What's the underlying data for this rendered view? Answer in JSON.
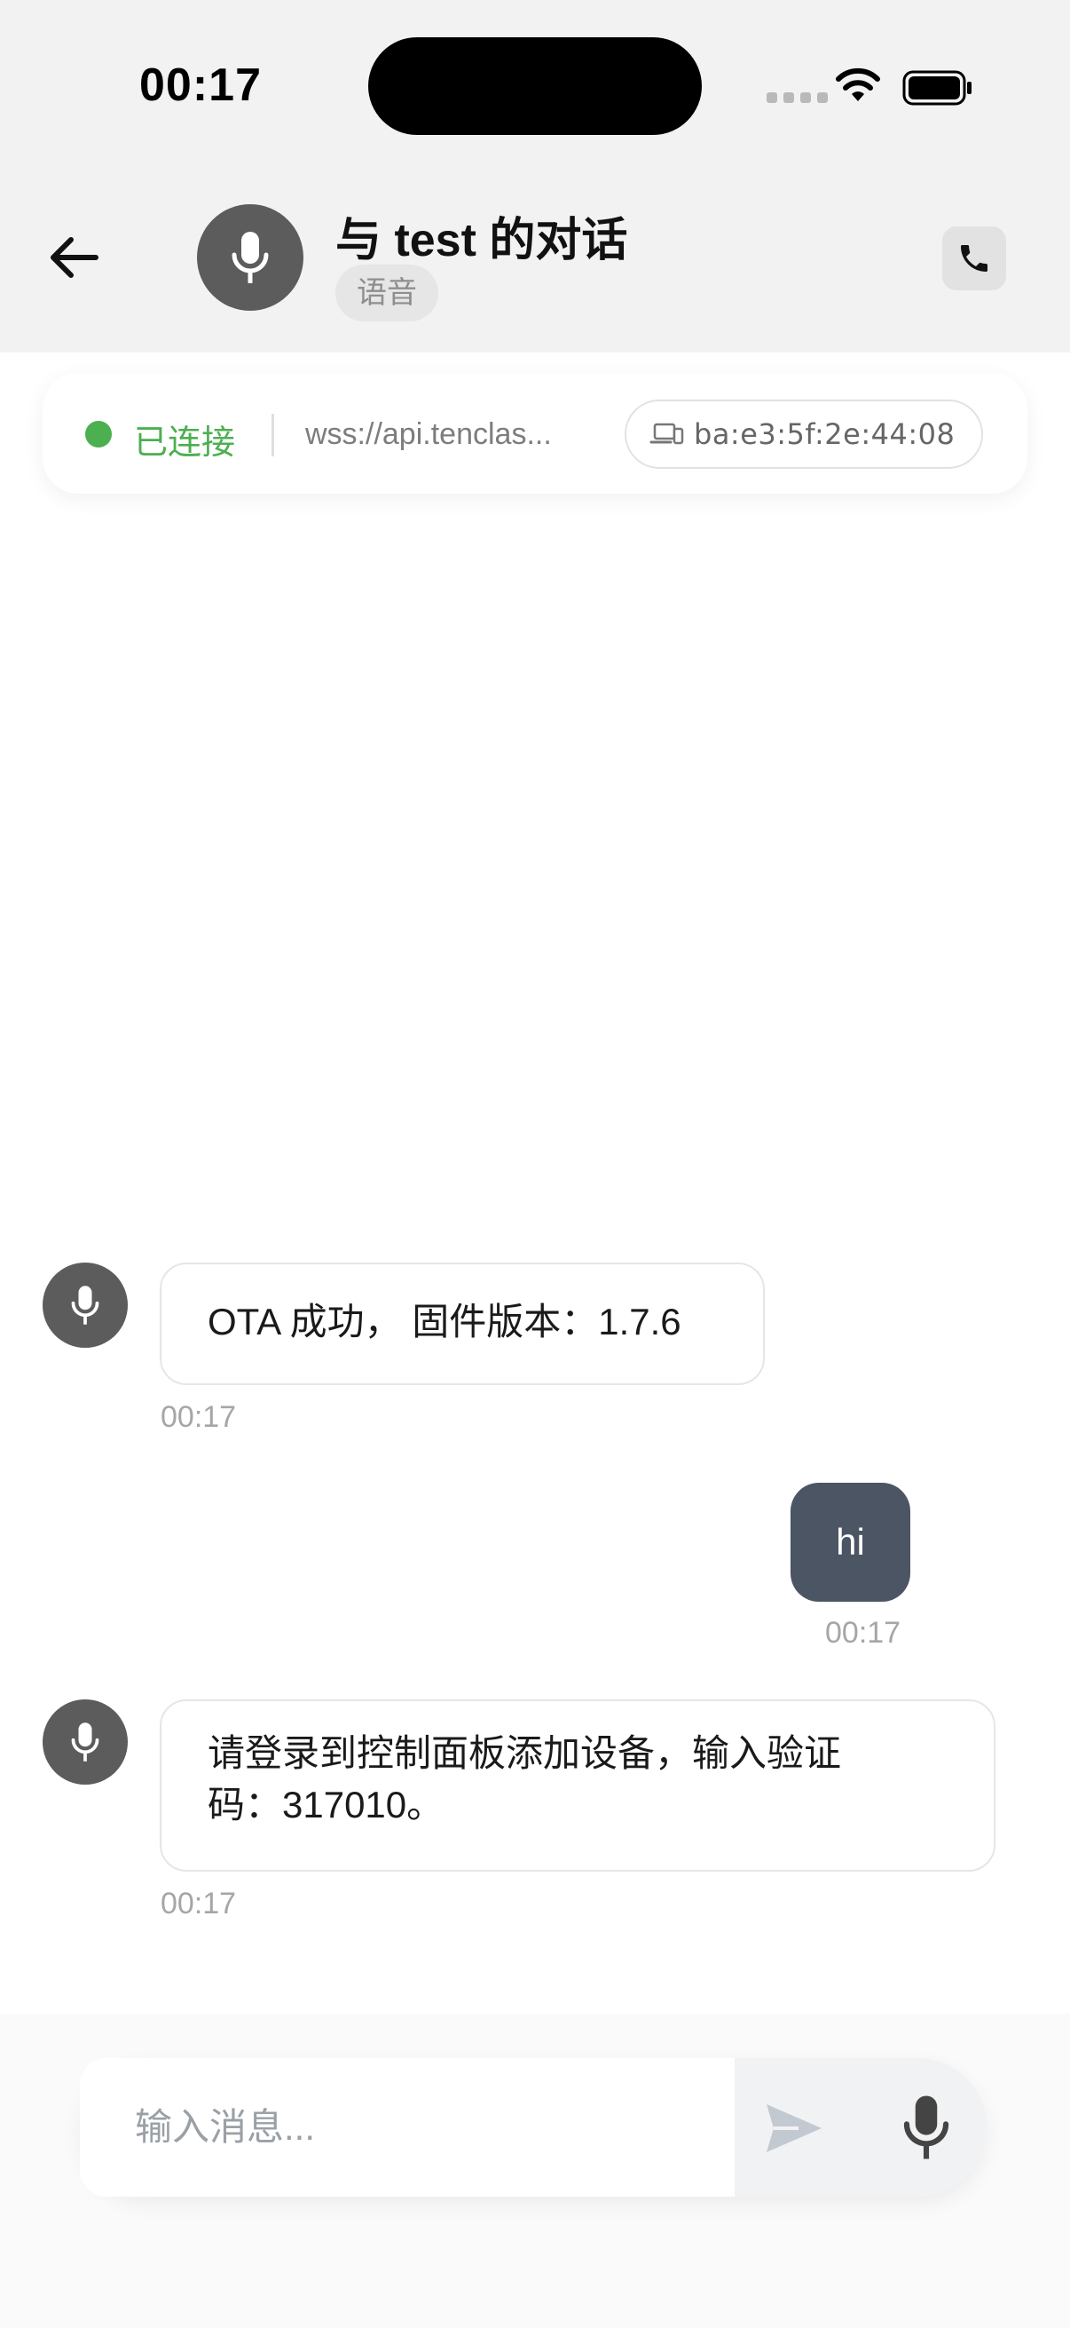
{
  "status_bar": {
    "time": "00:17"
  },
  "header": {
    "title": "与 test 的对话",
    "tag": "语音"
  },
  "connection": {
    "status": "已连接",
    "url": "wss://api.tenclas...",
    "mac": "ba:e3:5f:2e:44:08"
  },
  "messages": [
    {
      "from": "bot",
      "text": "OTA 成功， 固件版本：1.7.6",
      "time": "00:17"
    },
    {
      "from": "user",
      "text": "hi",
      "time": "00:17"
    },
    {
      "from": "bot",
      "text_line1": "请登录到控制面板添加设备，输入验证",
      "text_line2": "码：317010。",
      "time": "00:17"
    }
  ],
  "composer": {
    "placeholder": "输入消息..."
  },
  "colors": {
    "connected": "#4caf50",
    "user_bubble": "#4b5563",
    "avatar": "#5c5c5c"
  }
}
